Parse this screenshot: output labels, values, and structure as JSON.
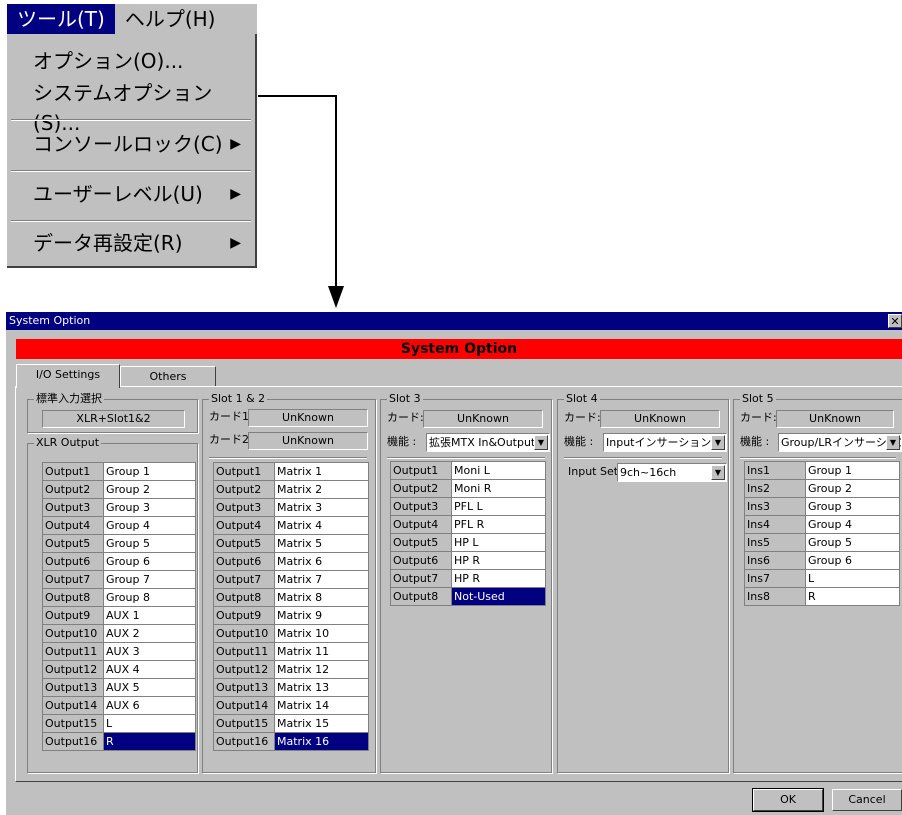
{
  "menu": {
    "bar": [
      "ツール(T)",
      "ヘルプ(H)"
    ],
    "items": [
      {
        "label": "オプション(O)...",
        "submenu": false
      },
      {
        "label": "システムオプション(S)...",
        "submenu": false
      },
      {
        "label": "コンソールロック(C)",
        "submenu": true
      },
      {
        "label": "ユーザーレベル(U)",
        "submenu": true
      },
      {
        "label": "データ再設定(R)",
        "submenu": true
      }
    ],
    "arrow": "▶"
  },
  "dialog": {
    "title": "System Option",
    "close": "✕",
    "banner": "System Option",
    "tabs": [
      "I/O Settings",
      "Others"
    ],
    "std_input": {
      "title": "標準入力選択",
      "value": "XLR+Slot1&2"
    },
    "xlr_output": {
      "title": "XLR Output",
      "rows": [
        [
          "Output1",
          "Group 1"
        ],
        [
          "Output2",
          "Group 2"
        ],
        [
          "Output3",
          "Group 3"
        ],
        [
          "Output4",
          "Group 4"
        ],
        [
          "Output5",
          "Group 5"
        ],
        [
          "Output6",
          "Group 6"
        ],
        [
          "Output7",
          "Group 7"
        ],
        [
          "Output8",
          "Group 8"
        ],
        [
          "Output9",
          "AUX 1"
        ],
        [
          "Output10",
          "AUX 2"
        ],
        [
          "Output11",
          "AUX 3"
        ],
        [
          "Output12",
          "AUX 4"
        ],
        [
          "Output13",
          "AUX 5"
        ],
        [
          "Output14",
          "AUX 6"
        ],
        [
          "Output15",
          "L"
        ],
        [
          "Output16",
          "R"
        ]
      ],
      "selected": 15
    },
    "slot12": {
      "title": "Slot 1 & 2",
      "card1_label": "カード1:",
      "card1_value": "UnKnown",
      "card2_label": "カード2:",
      "card2_value": "UnKnown",
      "rows": [
        [
          "Output1",
          "Matrix 1"
        ],
        [
          "Output2",
          "Matrix 2"
        ],
        [
          "Output3",
          "Matrix 3"
        ],
        [
          "Output4",
          "Matrix 4"
        ],
        [
          "Output5",
          "Matrix 5"
        ],
        [
          "Output6",
          "Matrix 6"
        ],
        [
          "Output7",
          "Matrix 7"
        ],
        [
          "Output8",
          "Matrix 8"
        ],
        [
          "Output9",
          "Matrix 9"
        ],
        [
          "Output10",
          "Matrix 10"
        ],
        [
          "Output11",
          "Matrix 11"
        ],
        [
          "Output12",
          "Matrix 12"
        ],
        [
          "Output13",
          "Matrix 13"
        ],
        [
          "Output14",
          "Matrix 14"
        ],
        [
          "Output15",
          "Matrix 15"
        ],
        [
          "Output16",
          "Matrix 16"
        ]
      ],
      "selected": 15
    },
    "slot3": {
      "title": "Slot 3",
      "card_label": "カード:",
      "card_value": "UnKnown",
      "func_label": "機能 :",
      "func_value": "拡張MTX In&Output",
      "rows": [
        [
          "Output1",
          "Moni L"
        ],
        [
          "Output2",
          "Moni R"
        ],
        [
          "Output3",
          "PFL L"
        ],
        [
          "Output4",
          "PFL R"
        ],
        [
          "Output5",
          "HP L"
        ],
        [
          "Output6",
          "HP R"
        ],
        [
          "Output7",
          "HP R"
        ],
        [
          "Output8",
          "Not-Used"
        ]
      ],
      "selected": 7
    },
    "slot4": {
      "title": "Slot 4",
      "card_label": "カード:",
      "card_value": "UnKnown",
      "func_label": "機能 :",
      "func_value": "Inputインサーション",
      "input_set_label": "Input Set:",
      "input_set_value": "9ch~16ch"
    },
    "slot5": {
      "title": "Slot 5",
      "card_label": "カード:",
      "card_value": "UnKnown",
      "func_label": "機能 :",
      "func_value": "Group/LRインサーション",
      "rows": [
        [
          "Ins1",
          "Group 1"
        ],
        [
          "Ins2",
          "Group 2"
        ],
        [
          "Ins3",
          "Group 3"
        ],
        [
          "Ins4",
          "Group 4"
        ],
        [
          "Ins5",
          "Group 5"
        ],
        [
          "Ins6",
          "Group 6"
        ],
        [
          "Ins7",
          "L"
        ],
        [
          "Ins8",
          "R"
        ]
      ],
      "selected": -1
    },
    "ok_label": "OK",
    "cancel_label": "Cancel",
    "dropdown_glyph": "▼"
  }
}
